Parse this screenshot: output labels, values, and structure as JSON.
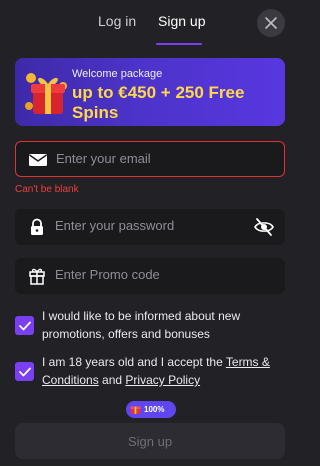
{
  "tabs": {
    "login": "Log in",
    "signup": "Sign up",
    "active": "signup"
  },
  "banner": {
    "subtitle": "Welcome package",
    "headline": "up to €450 + 250 Free Spins"
  },
  "email": {
    "placeholder": "Enter your email",
    "value": "",
    "error": "Can't be blank"
  },
  "password": {
    "placeholder": "Enter your password",
    "value": ""
  },
  "promo": {
    "placeholder": "Enter Promo code",
    "value": ""
  },
  "consents": {
    "marketing": {
      "checked": true,
      "text": "I would like to be informed about new promotions, offers and bonuses"
    },
    "terms": {
      "checked": true,
      "prefix": "I am 18 years old and I accept the ",
      "terms_link": "Terms & Conditions",
      "joiner": " and ",
      "privacy_link": "Privacy Policy"
    }
  },
  "submit": {
    "badge": "100%",
    "label": "Sign up"
  },
  "colors": {
    "background": "#222226",
    "accent": "#7b3ff2",
    "error": "#e0332f",
    "banner_highlight": "#ffd84a"
  }
}
